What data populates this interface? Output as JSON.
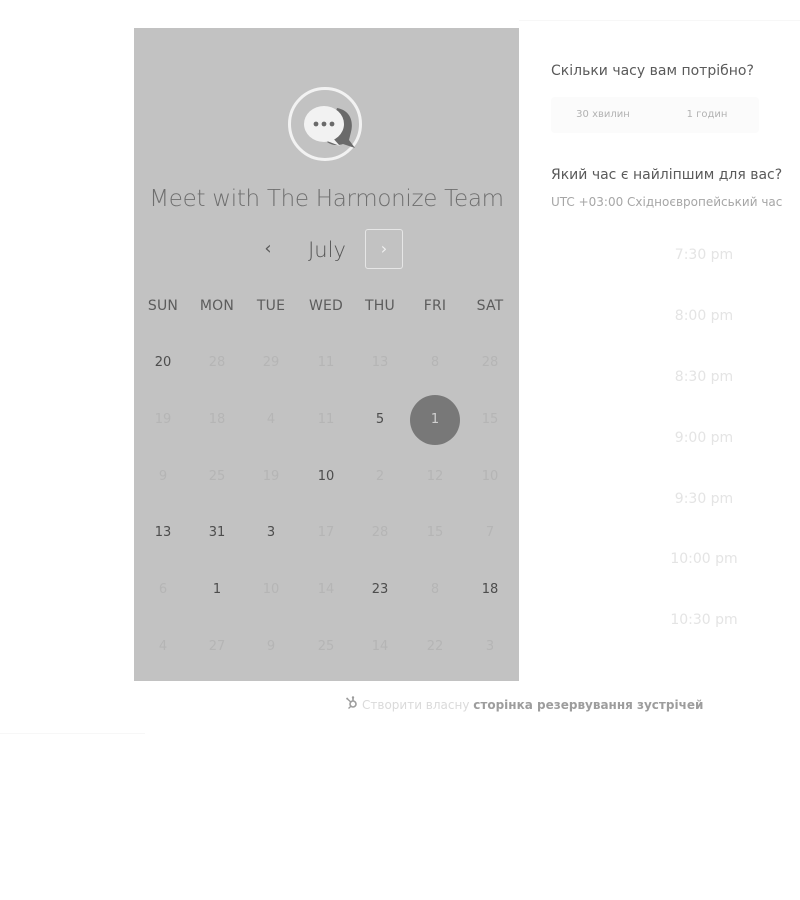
{
  "calendar": {
    "title": "Meet with The Harmonize Team",
    "month": "July",
    "prev_icon": "chevron-left-icon",
    "next_icon": "chevron-right-icon",
    "weekdays": [
      "SUN",
      "MON",
      "TUE",
      "WED",
      "THU",
      "FRI",
      "SAT"
    ],
    "weeks": [
      [
        "20",
        "28",
        "29",
        "11",
        "13",
        "8",
        "28"
      ],
      [
        "19",
        "18",
        "4",
        "11",
        "5",
        "1",
        "15"
      ],
      [
        "9",
        "25",
        "19",
        "10",
        "2",
        "12",
        "10"
      ],
      [
        "13",
        "31",
        "3",
        "17",
        "28",
        "15",
        "7"
      ],
      [
        "6",
        "1",
        "10",
        "14",
        "23",
        "8",
        "18"
      ],
      [
        "4",
        "27",
        "9",
        "25",
        "14",
        "22",
        "3"
      ]
    ],
    "available": [
      [
        0,
        0
      ],
      [
        1,
        4
      ],
      [
        2,
        3
      ],
      [
        3,
        0
      ],
      [
        3,
        1
      ],
      [
        3,
        2
      ],
      [
        4,
        1
      ],
      [
        4,
        4
      ],
      [
        4,
        6
      ]
    ],
    "selected": [
      1,
      5
    ],
    "avatar_icon": "chat-bubble-icon"
  },
  "booking": {
    "duration_question": "Скільки часу вам потрібно?",
    "durations": [
      "30 хвилин",
      "1 годин"
    ],
    "time_question": "Який час є найліпшим для вас?",
    "timezone": "UTC +03:00 Східноєвропейський час",
    "slots": [
      "7:30 pm",
      "8:00 pm",
      "8:30 pm",
      "9:00 pm",
      "9:30 pm",
      "10:00 pm",
      "10:30 pm"
    ]
  },
  "footer": {
    "icon": "sprocket-icon",
    "light_text": "Створити власну",
    "bold_text": "сторінка резервування зустрічей"
  },
  "colors": {
    "panel_bg": "#c2c2c2",
    "selected_day": "#787878"
  }
}
